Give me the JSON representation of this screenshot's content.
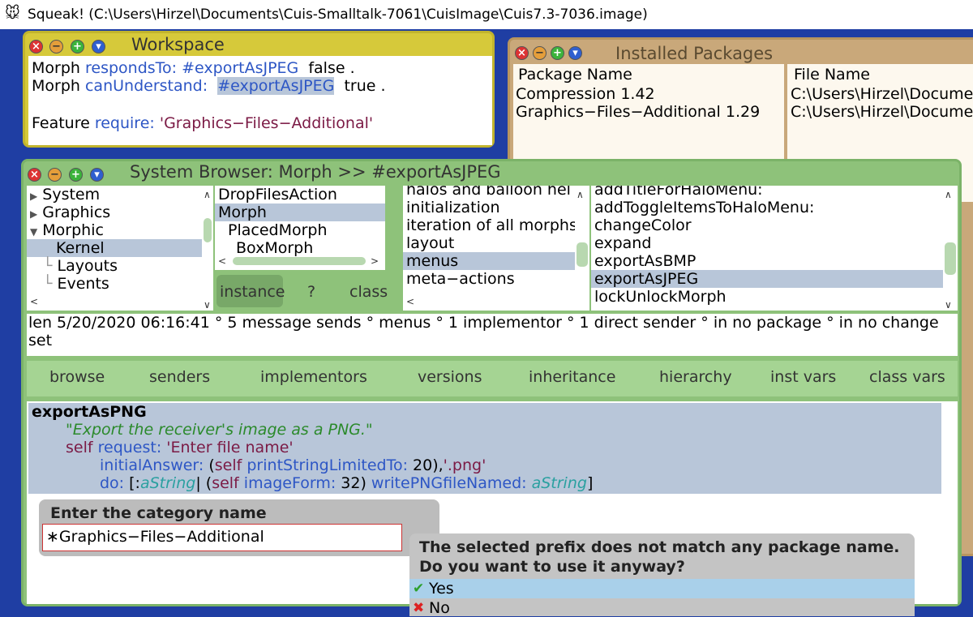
{
  "host": {
    "title": "Squeak! (C:\\Users\\Hirzel\\Documents\\Cuis-Smalltalk-7061\\CuisImage\\Cuis7.3-7036.image)"
  },
  "workspace": {
    "title": "Workspace",
    "line1": {
      "a": "Morph ",
      "b": "respondsTo: ",
      "c": "#exportAsJPEG",
      "d": "  false ."
    },
    "line2": {
      "a": "Morph ",
      "b": "canUnderstand:  ",
      "c": "#exportAsJPEG",
      "d": "  true ."
    },
    "line3": {
      "a": "Feature ",
      "b": "require: ",
      "c": "'Graphics−Files−Additional'"
    }
  },
  "packages": {
    "title": "Installed Packages",
    "col1_header": "Package Name",
    "col2_header": "File Name",
    "rows": [
      {
        "name": "Compression 1.42",
        "file": "C:\\Users\\Hirzel\\Docume"
      },
      {
        "name": "Graphics−Files−Additional 1.29",
        "file": "C:\\Users\\Hirzel\\Docume"
      }
    ]
  },
  "browser": {
    "title": "System Browser: Morph >> #exportAsJPEG",
    "categories": [
      "System",
      "Graphics",
      "Morphic",
      "Kernel",
      "Layouts",
      "Events"
    ],
    "classes": [
      "DropFilesAction",
      "Morph",
      "PlacedMorph",
      "BoxMorph"
    ],
    "instance_label": "instance",
    "question_label": "?",
    "class_label": "class",
    "protocols": [
      "halos and balloon hel",
      "initialization",
      "iteration of all morphs",
      "layout",
      "menus",
      "meta−actions"
    ],
    "methods": [
      "addTitleForHaloMenu:",
      "addToggleItemsToHaloMenu:",
      "changeColor",
      "expand",
      "exportAsBMP",
      "exportAsJPEG",
      "lockUnlockMorph"
    ],
    "status": "len 5/20/2020 06:16:41 ° 5 message sends ° menus ° 1 implementor ° 1 direct sender ° in no package ° in no change set",
    "buttons": [
      "browse",
      "senders",
      "implementors",
      "versions",
      "inheritance",
      "hierarchy",
      "inst vars",
      "class vars"
    ],
    "code": {
      "l1": "exportAsPNG",
      "l2": "\"Export the receiver's image as a PNG.\"",
      "l3a": "self ",
      "l3b": "request: ",
      "l3c": "'Enter file name'",
      "l4a": "initialAnswer: ",
      "l4b": "(",
      "l4c": "self ",
      "l4d": "printStringLimitedTo: ",
      "l4e": "20),",
      "l4f": "'.png'",
      "l5a": "do: ",
      "l5b": "[:",
      "l5c": "aString",
      "l5d": "| (",
      "l5e": "self ",
      "l5f": "imageForm: ",
      "l5g": "32) ",
      "l5h": "writePNGfileNamed: ",
      "l5i": "aString",
      "l5j": "]"
    }
  },
  "category_dialog": {
    "title": "Enter the category name",
    "value": "∗Graphics−Files−Additional"
  },
  "confirm_dialog": {
    "line1": "The selected prefix does not match any package name.",
    "line2": "Do you want to use it anyway?",
    "yes": "Yes",
    "no": "No"
  }
}
